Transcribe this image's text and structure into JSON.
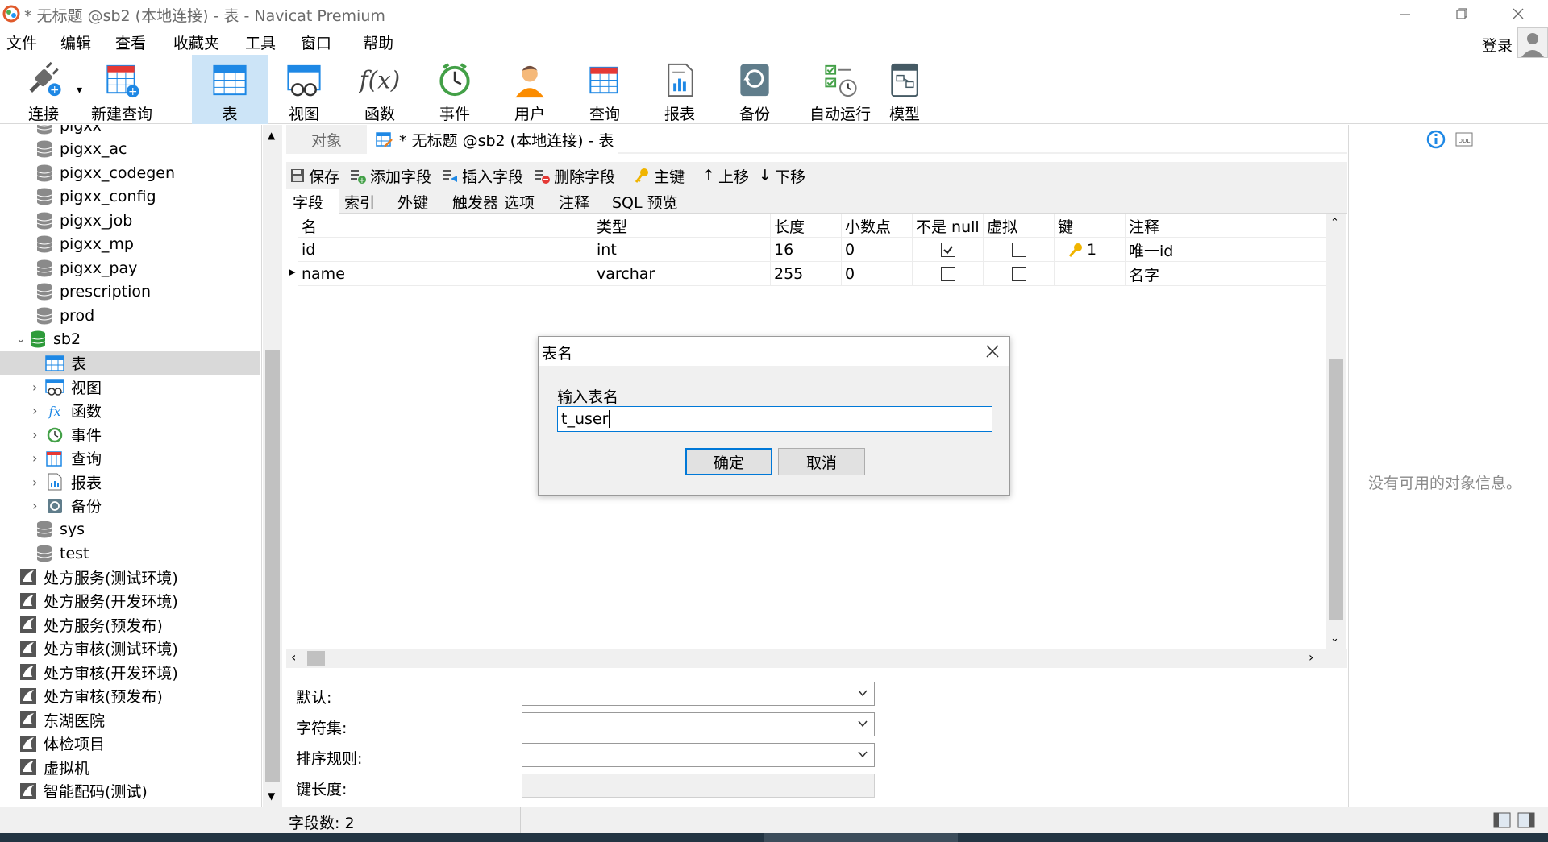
{
  "window": {
    "title": "* 无标题 @sb2 (本地连接) - 表 - Navicat Premium",
    "minimize_icon": "minimize-icon",
    "maximize_icon": "restore-icon",
    "close_icon": "close-icon"
  },
  "menubar": {
    "items": [
      "文件",
      "编辑",
      "查看",
      "收藏夹",
      "工具",
      "窗口",
      "帮助"
    ],
    "login": "登录"
  },
  "toolbar": {
    "items": [
      {
        "label": "连接",
        "icon": "plug-icon"
      },
      {
        "label": "新建查询",
        "icon": "new-query-icon"
      },
      {
        "label": "表",
        "icon": "table-icon",
        "active": true
      },
      {
        "label": "视图",
        "icon": "view-icon"
      },
      {
        "label": "函数",
        "icon": "function-icon"
      },
      {
        "label": "事件",
        "icon": "clock-icon"
      },
      {
        "label": "用户",
        "icon": "user-icon"
      },
      {
        "label": "查询",
        "icon": "query-icon"
      },
      {
        "label": "报表",
        "icon": "report-icon"
      },
      {
        "label": "备份",
        "icon": "backup-icon"
      },
      {
        "label": "自动运行",
        "icon": "schedule-icon"
      },
      {
        "label": "模型",
        "icon": "model-icon"
      }
    ]
  },
  "sidebar": {
    "databases": [
      "pigxx",
      "pigxx_ac",
      "pigxx_codegen",
      "pigxx_config",
      "pigxx_job",
      "pigxx_mp",
      "pigxx_pay",
      "prescription",
      "prod",
      "sb2"
    ],
    "sb2_children": [
      "表",
      "视图",
      "函数",
      "事件",
      "查询",
      "报表",
      "备份"
    ],
    "databases_after": [
      "sys",
      "test"
    ],
    "connections": [
      "处方服务(测试环境)",
      "处方服务(开发环境)",
      "处方服务(预发布)",
      "处方审核(测试环境)",
      "处方审核(开发环境)",
      "处方审核(预发布)",
      "东湖医院",
      "体检项目",
      "虚拟机",
      "智能配码(测试)"
    ]
  },
  "tabs": {
    "objects": "对象",
    "document": "* 无标题 @sb2 (本地连接) - 表"
  },
  "edit_toolbar": {
    "save": "保存",
    "add_field": "添加字段",
    "insert_field": "插入字段",
    "delete_field": "删除字段",
    "primary_key": "主键",
    "move_up": "上移",
    "move_down": "下移"
  },
  "subtabs": [
    "字段",
    "索引",
    "外键",
    "触发器",
    "选项",
    "注释",
    "SQL 预览"
  ],
  "grid": {
    "columns": [
      "名",
      "类型",
      "长度",
      "小数点",
      "不是 null",
      "虚拟",
      "键",
      "注释"
    ],
    "rows": [
      {
        "name": "id",
        "type": "int",
        "length": "16",
        "decimals": "0",
        "not_null": true,
        "virtual": false,
        "key": "1",
        "comment": "唯一id"
      },
      {
        "name": "name",
        "type": "varchar",
        "length": "255",
        "decimals": "0",
        "not_null": false,
        "virtual": false,
        "key": "",
        "comment": "名字"
      }
    ]
  },
  "props": {
    "default_label": "默认:",
    "charset_label": "字符集:",
    "collation_label": "排序规则:",
    "key_length_label": "键长度:"
  },
  "right_panel": {
    "empty_text": "没有可用的对象信息。"
  },
  "status": {
    "field_count": "字段数: 2"
  },
  "dialog": {
    "title": "表名",
    "prompt": "输入表名",
    "value": "t_user",
    "ok": "确定",
    "cancel": "取消"
  }
}
